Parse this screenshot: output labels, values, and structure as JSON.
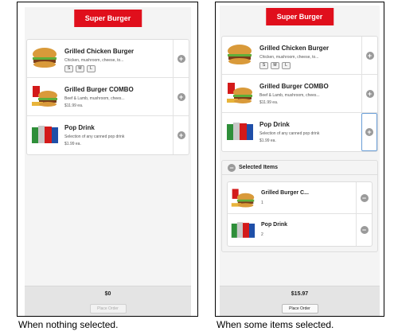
{
  "brand": {
    "label": "Super Burger",
    "color": "#e00f1c"
  },
  "menu_items": [
    {
      "title": "Grilled Chicken Burger",
      "desc": "Chicken, mushroom, cheese, to...",
      "sizes": [
        "S",
        "M",
        "L"
      ],
      "icon": "burger-icon"
    },
    {
      "title": "Grilled Burger COMBO",
      "desc": "Beef & Lamb, mushroom, chees...",
      "price": "$11.99 ea.",
      "icon": "combo-icon"
    },
    {
      "title": "Pop Drink",
      "desc": "Selection of any canned pop drink",
      "price": "$1.99 ea.",
      "icon": "soda-cans-icon"
    }
  ],
  "left": {
    "total": "$0",
    "order_label": "Place Order"
  },
  "right": {
    "selected_title": "Selected Items",
    "selected": [
      {
        "name": "Grilled Burger C...",
        "qty": "1"
      },
      {
        "name": "Pop Drink",
        "qty": "2"
      }
    ],
    "total": "$15.97",
    "order_label": "Place Order"
  },
  "captions": {
    "left": "When nothing selected.",
    "right": "When some items selected."
  }
}
